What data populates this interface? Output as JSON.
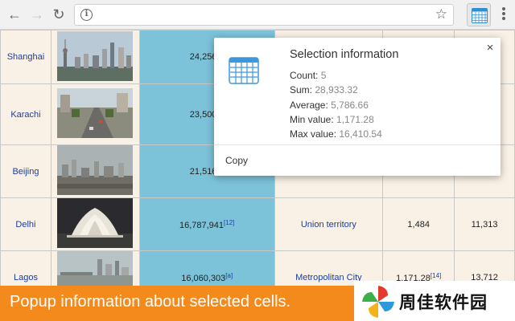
{
  "browser": {
    "icons": [
      "back-arrow-icon",
      "forward-arrow-icon",
      "reload-icon",
      "info-icon",
      "star-icon",
      "calendar-icon",
      "menu-dots-icon"
    ],
    "ext_color": "#2c8fd6"
  },
  "table": {
    "rows": [
      {
        "city": "Shanghai",
        "population": "24,256,8",
        "pop_ref": "",
        "type": "",
        "area": "",
        "density": ""
      },
      {
        "city": "Karachi",
        "population": "23,500,0",
        "pop_ref": "",
        "type": "",
        "area": "",
        "density": ""
      },
      {
        "city": "Beijing",
        "population": "21,516,0",
        "pop_ref": "",
        "type": "",
        "area": "",
        "density": ""
      },
      {
        "city": "Delhi",
        "population": "16,787,941",
        "pop_ref": "[12]",
        "type": "Union territory",
        "area": "1,484",
        "density": "11,313"
      },
      {
        "city": "Lagos",
        "population": "16,060,303",
        "pop_ref": "[a]",
        "type": "Metropolitan City",
        "area": "1,171.28",
        "area_ref": "[14]",
        "density": "13,712"
      }
    ],
    "selected_color": "#7cc3da"
  },
  "popup": {
    "title": "Selection information",
    "count_label": "Count:",
    "count_value": "5",
    "sum_label": "Sum:",
    "sum_value": "28,933.32",
    "avg_label": "Average:",
    "avg_value": "5,786.66",
    "min_label": "Min value:",
    "min_value": "1,171.28",
    "max_label": "Max value:",
    "max_value": "16,410.54",
    "copy_label": "Copy",
    "close_glyph": "×"
  },
  "banner": {
    "text": "Popup information about selected cells.",
    "color": "#f58a1c"
  },
  "brand": {
    "name": "周佳软件园"
  }
}
